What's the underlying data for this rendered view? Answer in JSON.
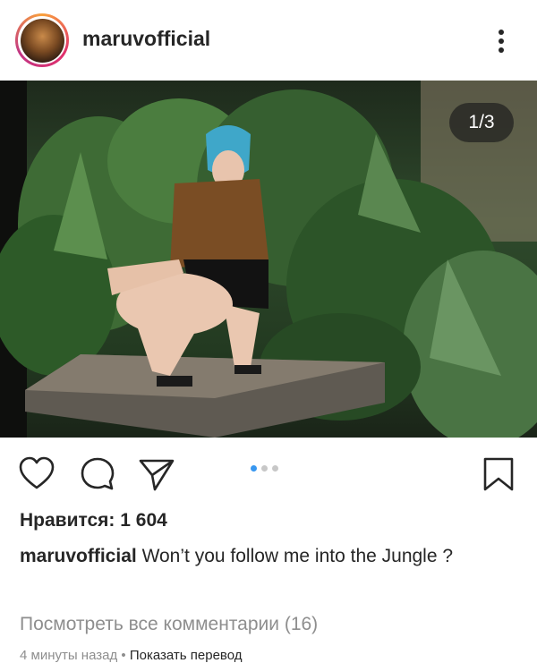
{
  "post": {
    "username": "maruvofficial",
    "counter": "1/3",
    "likes_text": "Нравится: 1 604",
    "caption_user": "maruvofficial",
    "caption_text": "Won’t you follow me into the Jungle ?",
    "view_comments": "Посмотреть все комментарии (16)",
    "time_ago": "4 минуты назад",
    "separator": "•",
    "translate": "Показать перевод"
  },
  "icons": {
    "more": "more-vertical-icon",
    "like": "heart-icon",
    "comment": "comment-bubble-icon",
    "share": "paper-plane-icon",
    "save": "bookmark-icon"
  },
  "carousel": {
    "total": 3,
    "current": 1
  },
  "colors": {
    "accent": "#3897f0",
    "text": "#262626",
    "muted": "#8e8e8e"
  }
}
